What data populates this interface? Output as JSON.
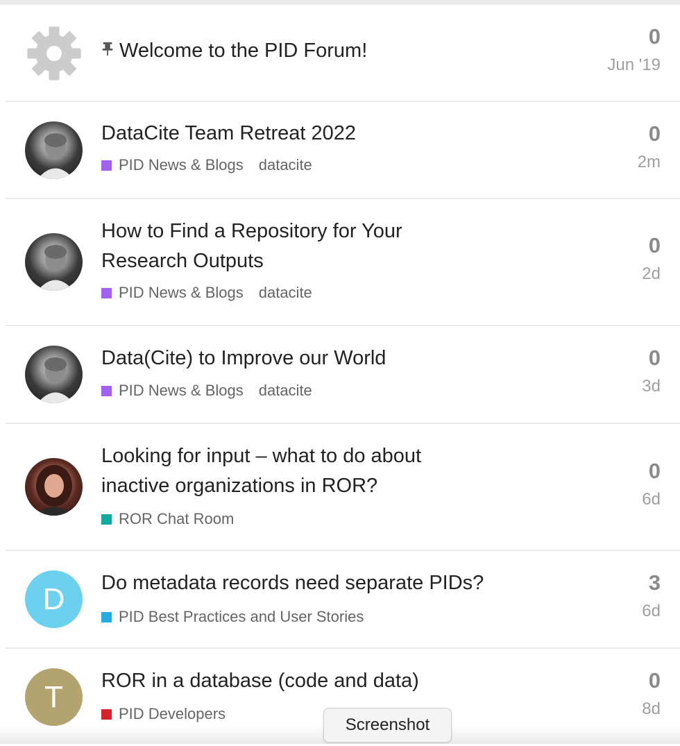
{
  "topics": [
    {
      "title": "Welcome to the PID Forum!",
      "pinned": true,
      "avatar": {
        "type": "icon",
        "icon": "gear-icon",
        "color": "#cccccc"
      },
      "category": null,
      "tag": null,
      "replies": "0",
      "age": "Jun '19"
    },
    {
      "title": "DataCite Team Retreat 2022",
      "pinned": false,
      "avatar": {
        "type": "photo"
      },
      "category": {
        "name": "PID News & Blogs",
        "color": "#a461ef"
      },
      "tag": "datacite",
      "replies": "0",
      "age": "2m"
    },
    {
      "title": "How to Find a Repository for Your Research Outputs",
      "pinned": false,
      "avatar": {
        "type": "photo"
      },
      "category": {
        "name": "PID News & Blogs",
        "color": "#a461ef"
      },
      "tag": "datacite",
      "replies": "0",
      "age": "2d"
    },
    {
      "title": "Data(Cite) to Improve our World",
      "pinned": false,
      "avatar": {
        "type": "photo"
      },
      "category": {
        "name": "PID News & Blogs",
        "color": "#a461ef"
      },
      "tag": "datacite",
      "replies": "0",
      "age": "3d"
    },
    {
      "title": "Looking for input – what to do about inactive organizations in ROR?",
      "pinned": false,
      "avatar": {
        "type": "photo"
      },
      "category": {
        "name": "ROR Chat Room",
        "color": "#12a89d"
      },
      "tag": null,
      "replies": "0",
      "age": "6d"
    },
    {
      "title": "Do metadata records need separate PIDs?",
      "pinned": false,
      "avatar": {
        "type": "letter",
        "letter": "D",
        "color": "#6bd1ef"
      },
      "category": {
        "name": "PID Best Practices and User Stories",
        "color": "#25aae2"
      },
      "tag": null,
      "replies": "3",
      "age": "6d"
    },
    {
      "title": "ROR in a database (code and data)",
      "pinned": false,
      "avatar": {
        "type": "letter",
        "letter": "T",
        "color": "#b3a36f"
      },
      "category": {
        "name": "PID Developers",
        "color": "#d3242e"
      },
      "tag": null,
      "replies": "0",
      "age": "8d"
    }
  ],
  "tooltip": {
    "label": "Screenshot"
  }
}
